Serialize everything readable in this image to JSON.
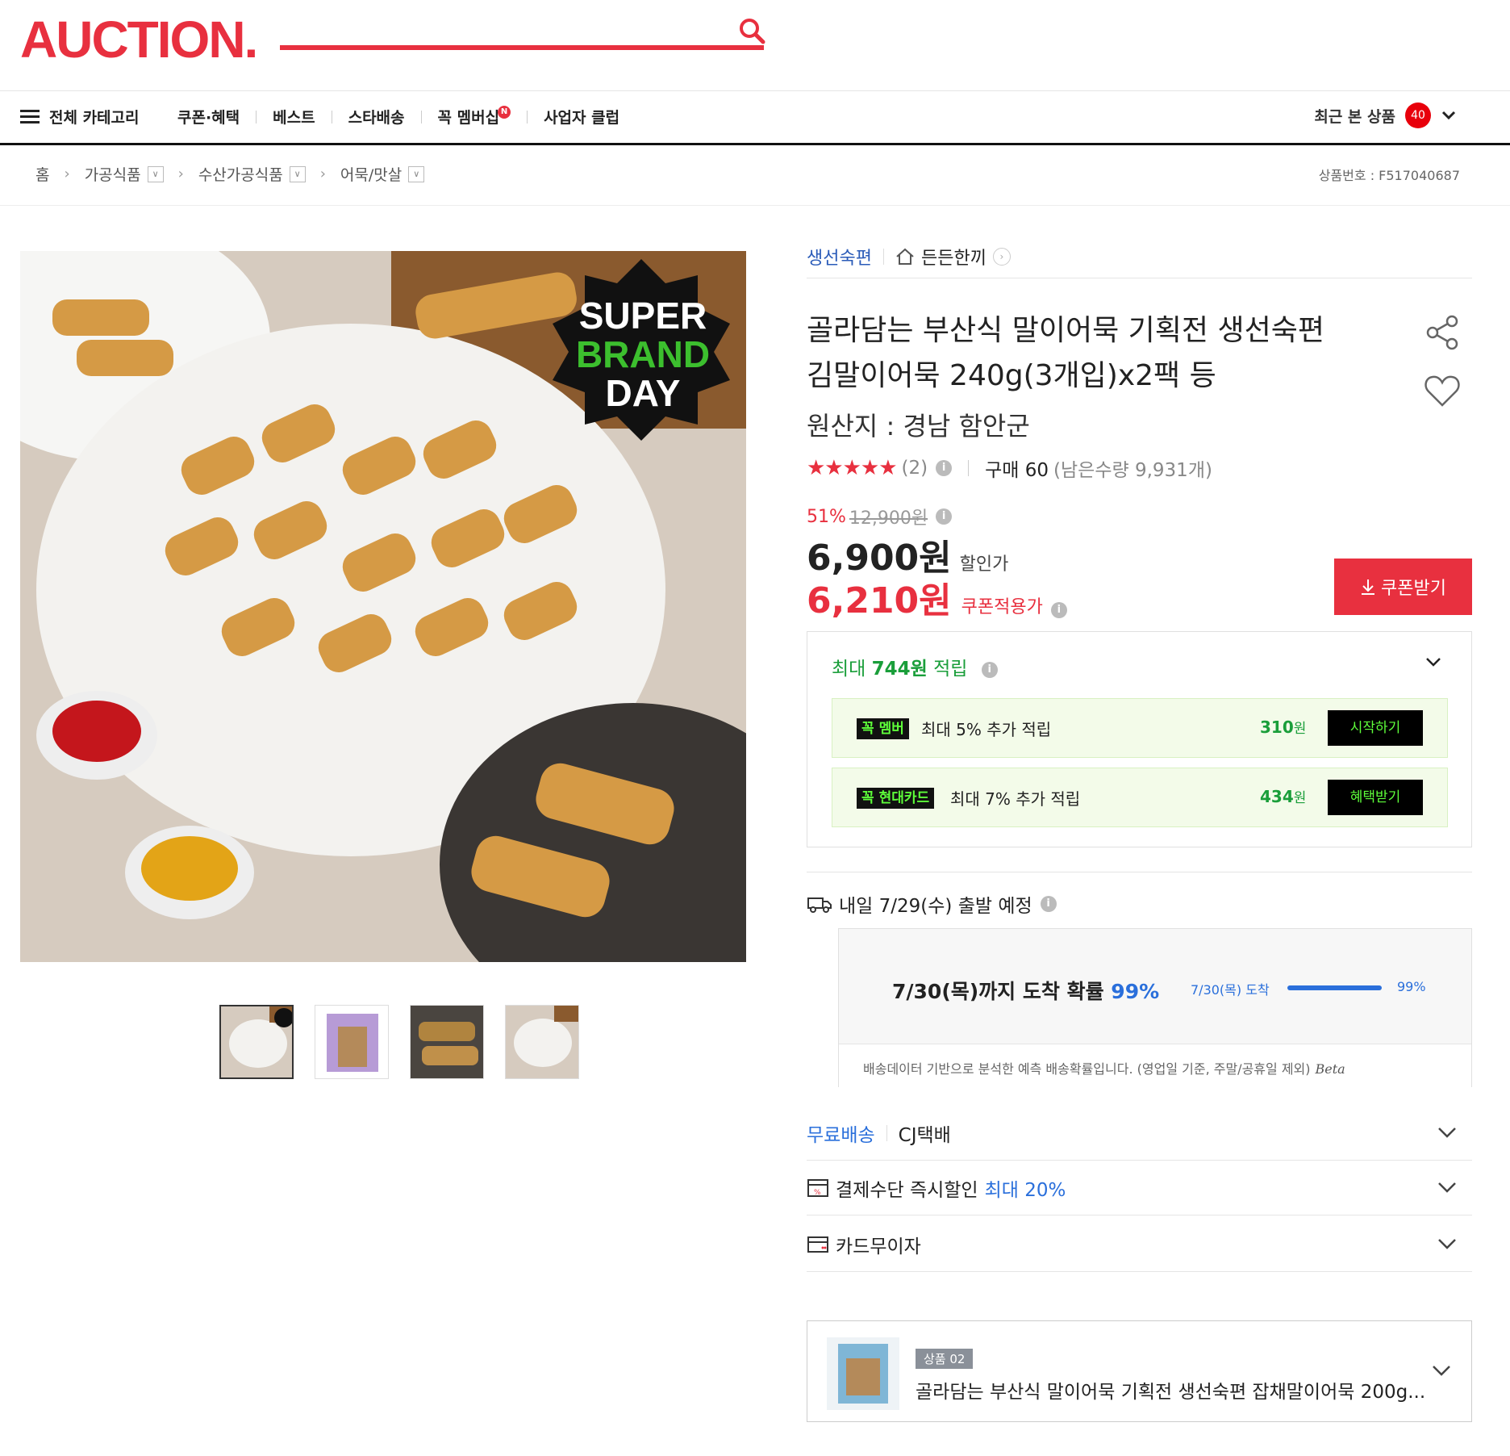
{
  "header": {
    "logo": "AUCTION.",
    "menu_label": "전체 카테고리",
    "nav": [
      {
        "label": "쿠폰·혜택"
      },
      {
        "label": "베스트"
      },
      {
        "label": "스타배송"
      },
      {
        "label": "꼭 멤버십",
        "badge": "N"
      },
      {
        "label": "사업자 클럽"
      }
    ],
    "recent_label": "최근 본 상품",
    "recent_count": "40"
  },
  "breadcrumb": {
    "home": "홈",
    "items": [
      "가공식품",
      "수산가공식품",
      "어묵/맛살"
    ],
    "product_no": "상품번호 : F517040687"
  },
  "image": {
    "badge_line1": "SUPER",
    "badge_line2": "BRAND",
    "badge_line3": "DAY"
  },
  "product": {
    "seller": "생선숙편",
    "store": "든든한끼",
    "title_line1": "골라담는 부산식 말이어묵 기획전 생선숙편",
    "title_line2": "김말이어묵 240g(3개입)x2팩 등",
    "origin": "원산지 : 경남 함안군",
    "stars": "★★★★★",
    "review_count": "(2)",
    "purchase": "구매 60",
    "remaining": "(남은수량 9,931개)",
    "rating_value": 5
  },
  "price": {
    "discount_pct": "51%",
    "original": "12,900원",
    "sale": "6,900원",
    "sale_label": "할인가",
    "coupon": "6,210원",
    "coupon_label": "쿠폰적용가",
    "coupon_button": "쿠폰받기"
  },
  "points": {
    "prefix": "최대",
    "amount": "744원",
    "suffix": "적립",
    "rows": [
      {
        "tag_a": "꼭",
        "tag_b": "멤버",
        "text": "최대 5% 추가 적립",
        "amount": "310",
        "unit": "원",
        "button": "시작하기"
      },
      {
        "tag_a": "꼭",
        "tag_b": "현대카드",
        "text": "최대 7% 추가 적립",
        "amount": "434",
        "unit": "원",
        "button": "혜택받기"
      }
    ]
  },
  "shipping": {
    "depart": "내일 7/29(수) 출발 예정",
    "eta_big": "7/30(목)까지 도착 확률",
    "eta_pct": "99%",
    "eta_small_label": "7/30(목) 도착",
    "eta_small_pct": "99%",
    "eta_probability": 0.99,
    "note": "배송데이터 기반으로 분석한 예측 배송확률입니다. (영업일 기준, 주말/공휴일 제외)",
    "beta": "Beta"
  },
  "rows": {
    "free_ship": "무료배송",
    "courier": "CJ택배",
    "payment": "결제수단 즉시할인",
    "payment_max": "최대 20%",
    "installment": "카드무이자"
  },
  "option": {
    "tag": "상품 02",
    "name": "골라담는 부산식 말이어묵 기획전 생선숙편 잡채말이어묵 200g..."
  },
  "colors": {
    "brand_red": "#e8303f",
    "link_blue": "#2a6fdb",
    "point_green": "#1a9e3a"
  }
}
